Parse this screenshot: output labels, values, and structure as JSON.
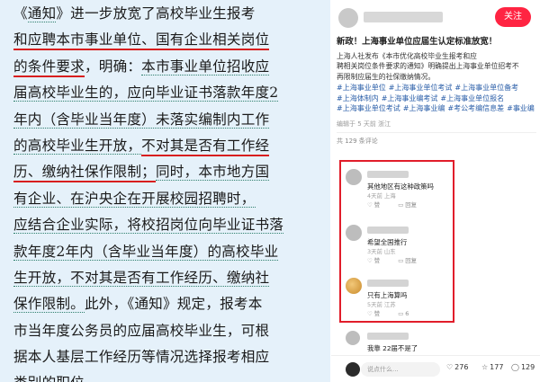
{
  "document": {
    "lines": [
      [
        {
          "t": "《",
          "s": ""
        },
        {
          "t": "通知",
          "s": "dot"
        },
        {
          "t": "》进一步放宽了高校毕业生报考",
          "s": ""
        }
      ],
      [
        {
          "t": "和应聘本市事业单位、国有企业相关岗位",
          "s": "red"
        }
      ],
      [
        {
          "t": "的条件要求",
          "s": "red"
        },
        {
          "t": "，明确：",
          "s": ""
        },
        {
          "t": "本市事业单位招收应",
          "s": "dot"
        }
      ],
      [
        {
          "t": "届高校毕业生的，应向毕业证书落款年度2",
          "s": "dot"
        }
      ],
      [
        {
          "t": "年内（含毕业当年度）未落实编制内工作",
          "s": "dot"
        }
      ],
      [
        {
          "t": "的高校毕业生开放，",
          "s": "dot"
        },
        {
          "t": "不对其是否有工作经",
          "s": "red"
        }
      ],
      [
        {
          "t": "历、缴纳社保作限制；",
          "s": "red"
        },
        {
          "t": "同时，本市地方国",
          "s": "dot"
        }
      ],
      [
        {
          "t": "有企业、在沪央企在开展校园招聘时，",
          "s": "dot"
        }
      ],
      [
        {
          "t": "应结合企业实际，将校招岗位向毕业证书落",
          "s": "dot"
        }
      ],
      [
        {
          "t": "款年度2年内（含毕业当年度）的高校毕业",
          "s": "dot"
        }
      ],
      [
        {
          "t": "生开放，不对其是否有工作经历、缴纳社",
          "s": "dot"
        }
      ],
      [
        {
          "t": "保作限制。",
          "s": "dot"
        },
        {
          "t": "此外，《通知》规定，报考本",
          "s": ""
        }
      ],
      [
        {
          "t": "市当年度公务员的应届高校毕业生，可根",
          "s": ""
        }
      ],
      [
        {
          "t": "据本人基层工作经历等情况选择报考相应",
          "s": ""
        }
      ],
      [
        {
          "t": "类别的职位。",
          "s": ""
        }
      ]
    ]
  },
  "post": {
    "follow_label": "关注",
    "title": "新政！上海事业单位应届生认定标准放宽！",
    "body_lines": [
      "上海人社发布《本市优化高校毕业生报考和应",
      "聘相关岗位条件要求的通知》明确提出上海事业单位招考不",
      "再限制应届生的社保缴纳情况。"
    ],
    "tag_rows": [
      [
        "#上海事业单位",
        "#上海事业单位考试",
        "#上海事业单位备考"
      ],
      [
        "#上海体制内",
        "#上海事业编考试",
        "#上海事业单位报名"
      ],
      [
        "#上海事业单位考试",
        "#上海事业编",
        "#考公考编信息差",
        "#事业编"
      ]
    ],
    "meta": "编辑于 5 天前  浙江",
    "comment_count": "共 129 条评论",
    "comments": [
      {
        "text": "其他地区有这种政策吗",
        "meta": "4天前  上海",
        "likes": "赞",
        "replies": "回复"
      },
      {
        "text": "希望全国推行",
        "meta": "3天前  山东",
        "likes": "赞",
        "replies": "回复"
      },
      {
        "text": "只有上海算吗",
        "meta": "5天前  江苏",
        "likes": "赞",
        "replies": "6"
      },
      {
        "text": "我靠 22届不是了",
        "meta": "",
        "likes": "",
        "replies": ""
      }
    ],
    "bottom": {
      "say_placeholder": "说点什么...",
      "likes": "276",
      "stars": "177",
      "comments": "129"
    }
  }
}
